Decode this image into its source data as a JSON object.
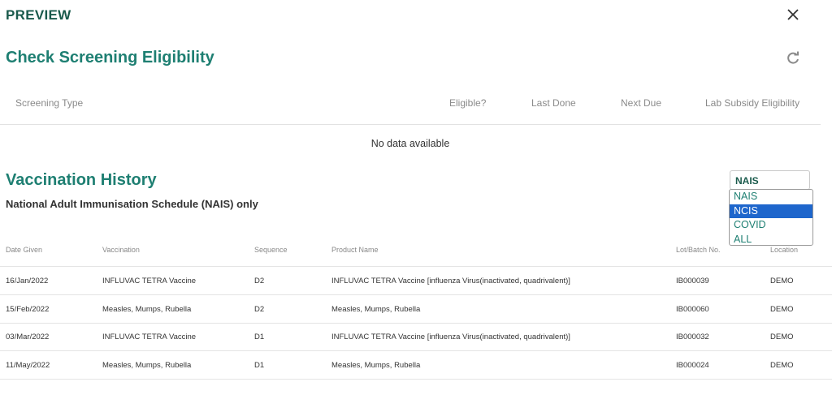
{
  "header": {
    "title": "PREVIEW"
  },
  "screening": {
    "title": "Check Screening Eligibility",
    "columns": [
      "Screening Type",
      "Eligible?",
      "Last Done",
      "Next Due",
      "Lab Subsidy Eligibility"
    ],
    "empty_text": "No data available"
  },
  "vaccination": {
    "title": "Vaccination History",
    "subtitle": "National Adult Immunisation Schedule (NAIS) only",
    "filter": {
      "selected": "NAIS",
      "options": [
        "NAIS",
        "NCIS",
        "COVID",
        "ALL"
      ],
      "highlighted": "NCIS"
    },
    "columns": [
      "Date Given",
      "Vaccination",
      "Sequence",
      "Product Name",
      "Lot/Batch No.",
      "Location"
    ],
    "rows": [
      [
        "16/Jan/2022",
        "INFLUVAC TETRA Vaccine",
        "D2",
        "INFLUVAC TETRA Vaccine [influenza Virus(inactivated, quadrivalent)]",
        "IB000039",
        "DEMO"
      ],
      [
        "15/Feb/2022",
        "Measles, Mumps, Rubella",
        "D2",
        "Measles, Mumps, Rubella",
        "IB000060",
        "DEMO"
      ],
      [
        "03/Mar/2022",
        "INFLUVAC TETRA Vaccine",
        "D1",
        "INFLUVAC TETRA Vaccine [influenza Virus(inactivated, quadrivalent)]",
        "IB000032",
        "DEMO"
      ],
      [
        "11/May/2022",
        "Measles, Mumps, Rubella",
        "D1",
        "Measles, Mumps, Rubella",
        "IB000024",
        "DEMO"
      ]
    ]
  },
  "icons": {
    "close": "close-icon",
    "refresh": "refresh-icon"
  },
  "colors": {
    "title_dark": "#1a5a4c",
    "title_teal": "#1e7f72",
    "selected_option": "#1e66cc"
  }
}
